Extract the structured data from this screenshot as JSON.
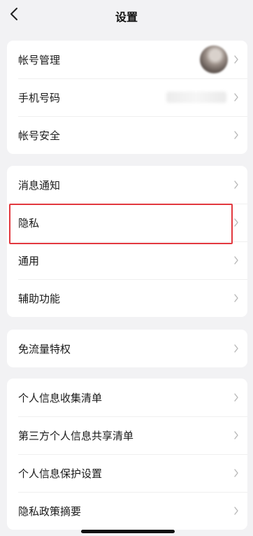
{
  "navbar": {
    "title": "设置"
  },
  "group1": {
    "items": [
      {
        "label": "帐号管理"
      },
      {
        "label": "手机号码"
      },
      {
        "label": "帐号安全"
      }
    ]
  },
  "group2": {
    "items": [
      {
        "label": "消息通知"
      },
      {
        "label": "隐私"
      },
      {
        "label": "通用"
      },
      {
        "label": "辅助功能"
      }
    ]
  },
  "group3": {
    "items": [
      {
        "label": "免流量特权"
      }
    ]
  },
  "group4": {
    "items": [
      {
        "label": "个人信息收集清单"
      },
      {
        "label": "第三方个人信息共享清单"
      },
      {
        "label": "个人信息保护设置"
      },
      {
        "label": "隐私政策摘要"
      }
    ]
  },
  "colors": {
    "background": "#f2f2f4",
    "card": "#ffffff",
    "highlight": "#e2383f",
    "chevron": "#b8b8b8"
  }
}
